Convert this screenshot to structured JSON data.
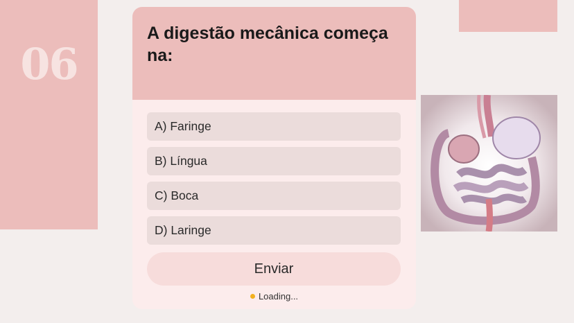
{
  "slide": {
    "number": "06"
  },
  "question": {
    "text": "A digestão mecânica começa na:"
  },
  "options": [
    {
      "label": "A) Faringe"
    },
    {
      "label": "B) Língua"
    },
    {
      "label": "C) Boca"
    },
    {
      "label": "D) Laringe"
    }
  ],
  "submit": {
    "label": "Enviar"
  },
  "status": {
    "text": "Loading..."
  },
  "colors": {
    "background": "#f3eeed",
    "panel": "#ecbdbb",
    "card": "#fcecec",
    "option": "#ebdcdb",
    "button": "#f7dcdb",
    "loading_dot": "#f2b01e"
  },
  "illustration": {
    "icon": "digestive-system-illustration"
  }
}
